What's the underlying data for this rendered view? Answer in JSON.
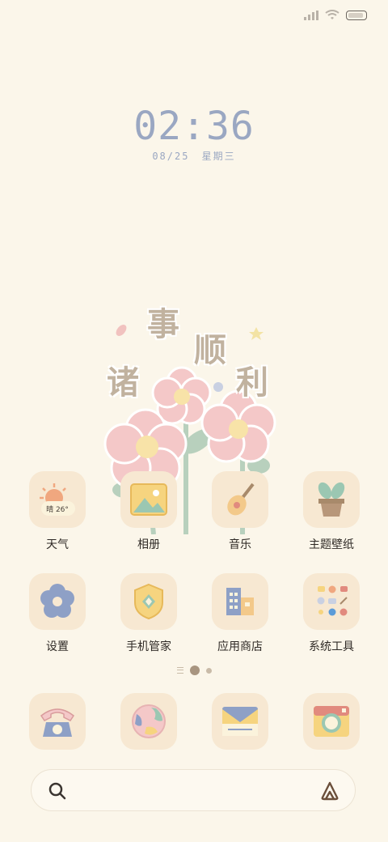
{
  "status_bar": {
    "icons": [
      "signal-icon",
      "wifi-icon",
      "battery-icon"
    ]
  },
  "lock_clock": {
    "time": "02:36",
    "date": "08/25",
    "weekday": "星期三"
  },
  "wallpaper": {
    "chars": [
      "事",
      "顺",
      "诸",
      "利"
    ]
  },
  "apps": [
    {
      "label": "天气",
      "icon": "weather-icon",
      "badge": "晴 26°"
    },
    {
      "label": "相册",
      "icon": "photo-album-icon"
    },
    {
      "label": "音乐",
      "icon": "guitar-icon"
    },
    {
      "label": "主题壁纸",
      "icon": "potted-plant-icon"
    },
    {
      "label": "设置",
      "icon": "flower-gear-icon"
    },
    {
      "label": "手机管家",
      "icon": "shield-icon"
    },
    {
      "label": "应用商店",
      "icon": "building-icon"
    },
    {
      "label": "系统工具",
      "icon": "folder-icon"
    }
  ],
  "page_indicator": {
    "pages": 2,
    "current": 1
  },
  "dock": [
    {
      "icon": "phone-icon"
    },
    {
      "icon": "globe-icon"
    },
    {
      "icon": "message-icon"
    },
    {
      "icon": "camera-icon"
    }
  ],
  "search": {
    "left_icon": "search-icon",
    "right_icon": "assistant-icon"
  },
  "colors": {
    "background": "#fbf6ea",
    "icon_tile": "#f7e8d2",
    "clock": "#9aa7c2"
  }
}
